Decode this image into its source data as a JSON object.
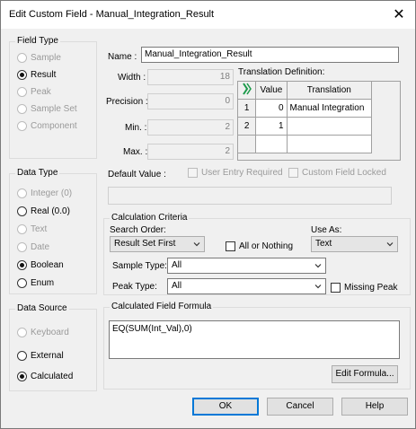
{
  "window": {
    "title": "Edit Custom Field - Manual_Integration_Result",
    "close_glyph": "✕"
  },
  "field_type": {
    "label": "Field Type",
    "options": [
      "Sample",
      "Result",
      "Peak",
      "Sample Set",
      "Component"
    ],
    "selected": "Result"
  },
  "data_type": {
    "label": "Data Type",
    "options": [
      "Integer (0)",
      "Real (0.0)",
      "Text",
      "Date",
      "Boolean",
      "Enum"
    ],
    "selected": "Boolean"
  },
  "data_source": {
    "label": "Data Source",
    "options": [
      "Keyboard",
      "External",
      "Calculated"
    ],
    "selected": "Calculated"
  },
  "props": {
    "name_label": "Name :",
    "name_value": "Manual_Integration_Result",
    "width_label": "Width :",
    "width_value": "18",
    "precision_label": "Precision :",
    "precision_value": "0",
    "min_label": "Min. :",
    "min_value": "2",
    "max_label": "Max. :",
    "max_value": "2",
    "default_label": "Default Value :",
    "user_entry_label": "User Entry Required",
    "custom_locked_label": "Custom Field Locked"
  },
  "translation": {
    "label": "Translation Definition:",
    "headers": [
      "Value",
      "Translation"
    ],
    "rows": [
      {
        "num": "1",
        "value": "0",
        "translation": "Manual Integration"
      },
      {
        "num": "2",
        "value": "1",
        "translation": ""
      }
    ]
  },
  "calc": {
    "label": "Calculation Criteria",
    "search_order_label": "Search Order:",
    "search_order_value": "Result Set First",
    "all_or_nothing_label": "All or Nothing",
    "use_as_label": "Use As:",
    "use_as_value": "Text",
    "sample_type_label": "Sample Type:",
    "sample_type_value": "All",
    "peak_type_label": "Peak Type:",
    "peak_type_value": "All",
    "missing_peak_label": "Missing Peak"
  },
  "formula": {
    "label": "Calculated Field Formula",
    "value": "EQ(SUM(Int_Val),0)",
    "edit_button": "Edit Formula..."
  },
  "buttons": {
    "ok": "OK",
    "cancel": "Cancel",
    "help": "Help"
  }
}
